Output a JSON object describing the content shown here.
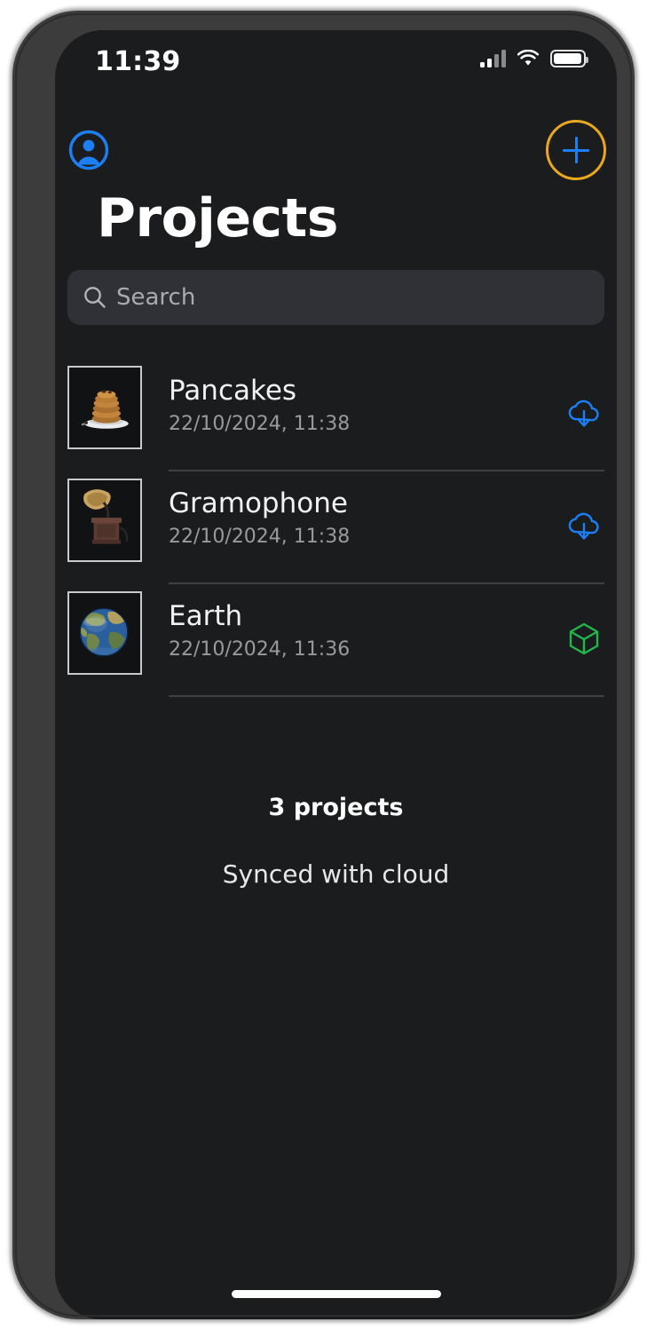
{
  "status_bar": {
    "time": "11:39",
    "signal_icon": "cellular-signal-icon",
    "signal_bars_filled": 2,
    "signal_bars_total": 4,
    "wifi_icon": "wifi-icon",
    "battery_icon": "battery-icon"
  },
  "topbar": {
    "avatar_icon": "account-circle-icon",
    "add_icon": "plus-icon",
    "add_ring_color": "#eaa81f",
    "plus_color": "#1d7ff5"
  },
  "header": {
    "title": "Projects"
  },
  "search": {
    "placeholder": "Search",
    "value": "",
    "icon": "search-icon"
  },
  "projects": [
    {
      "name": "Pancakes",
      "date": "22/10/2024, 11:38",
      "thumbnail": "pancakes-thumbnail",
      "status_icon": "cloud-download-icon",
      "status_color": "#1d7ff5"
    },
    {
      "name": "Gramophone",
      "date": "22/10/2024, 11:38",
      "thumbnail": "gramophone-thumbnail",
      "status_icon": "cloud-download-icon",
      "status_color": "#1d7ff5"
    },
    {
      "name": "Earth",
      "date": "22/10/2024, 11:36",
      "thumbnail": "earth-thumbnail",
      "status_icon": "cube-3d-icon",
      "status_color": "#21b84a"
    }
  ],
  "footer": {
    "count_label": "3 projects",
    "sync_label": "Synced with cloud"
  },
  "colors": {
    "screen_background": "#1b1c1e",
    "search_background": "#303136",
    "accent_blue": "#1d7ff5",
    "accent_orange": "#eaa81f",
    "accent_green": "#21b84a"
  }
}
